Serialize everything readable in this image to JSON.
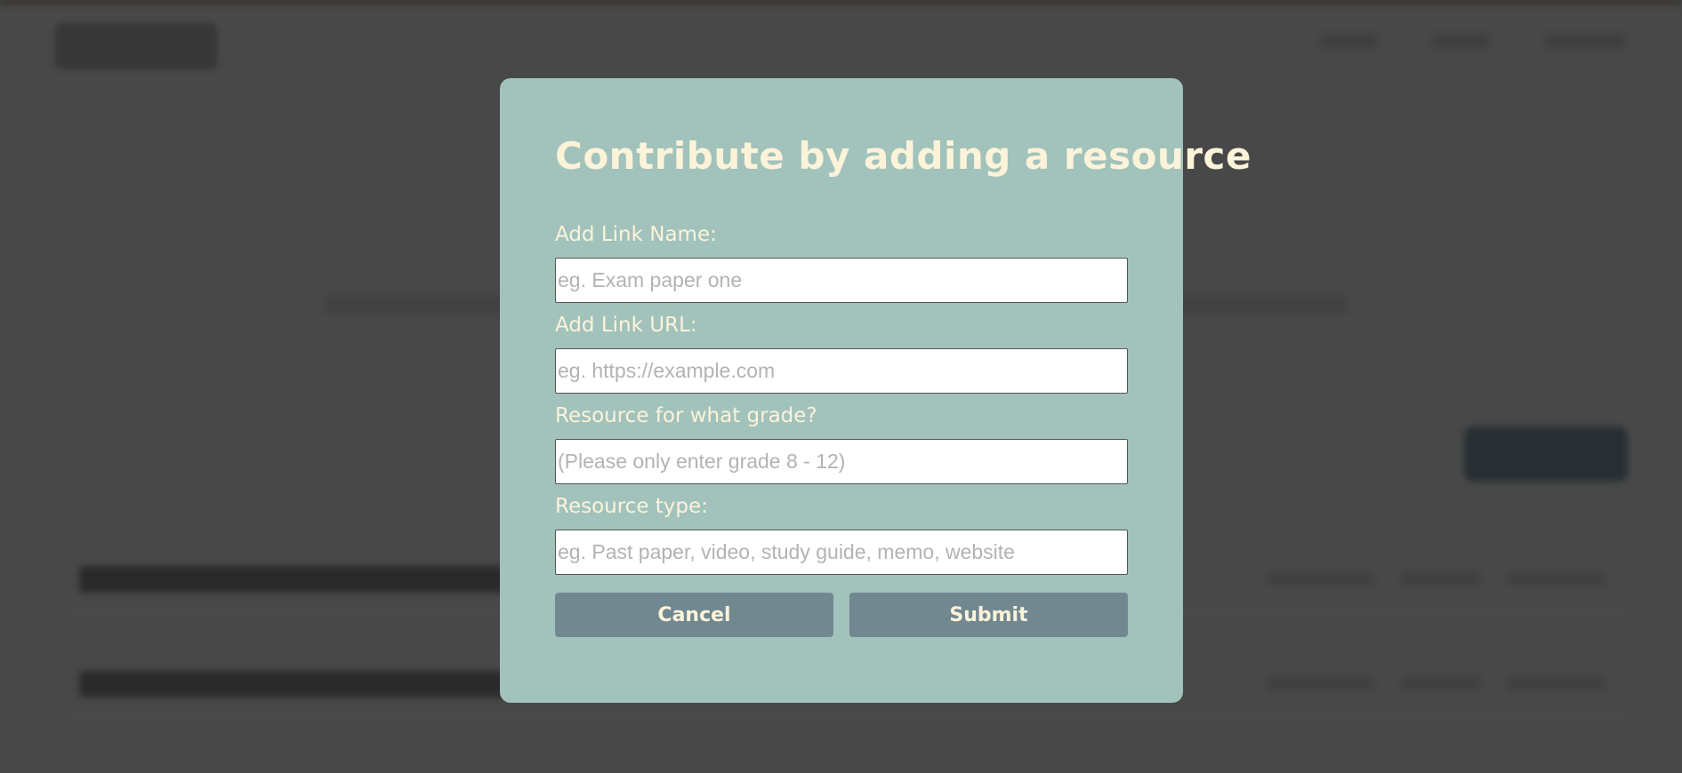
{
  "modal": {
    "title": "Contribute by adding a resource",
    "fields": [
      {
        "label": "Add Link Name:",
        "placeholder": "eg. Exam paper one",
        "value": ""
      },
      {
        "label": "Add Link URL:",
        "placeholder": "eg. https://example.com",
        "value": ""
      },
      {
        "label": "Resource for what grade?",
        "placeholder": "(Please only enter grade 8 - 12)",
        "value": ""
      },
      {
        "label": "Resource type:",
        "placeholder": "eg. Past paper, video, study guide, memo, website",
        "value": ""
      }
    ],
    "cancel_label": "Cancel",
    "submit_label": "Submit"
  },
  "colors": {
    "modal_background": "#a2c2bc",
    "title_text": "#fcf3d9",
    "button_background": "#718891",
    "page_overlay": "#4f4f4f"
  }
}
